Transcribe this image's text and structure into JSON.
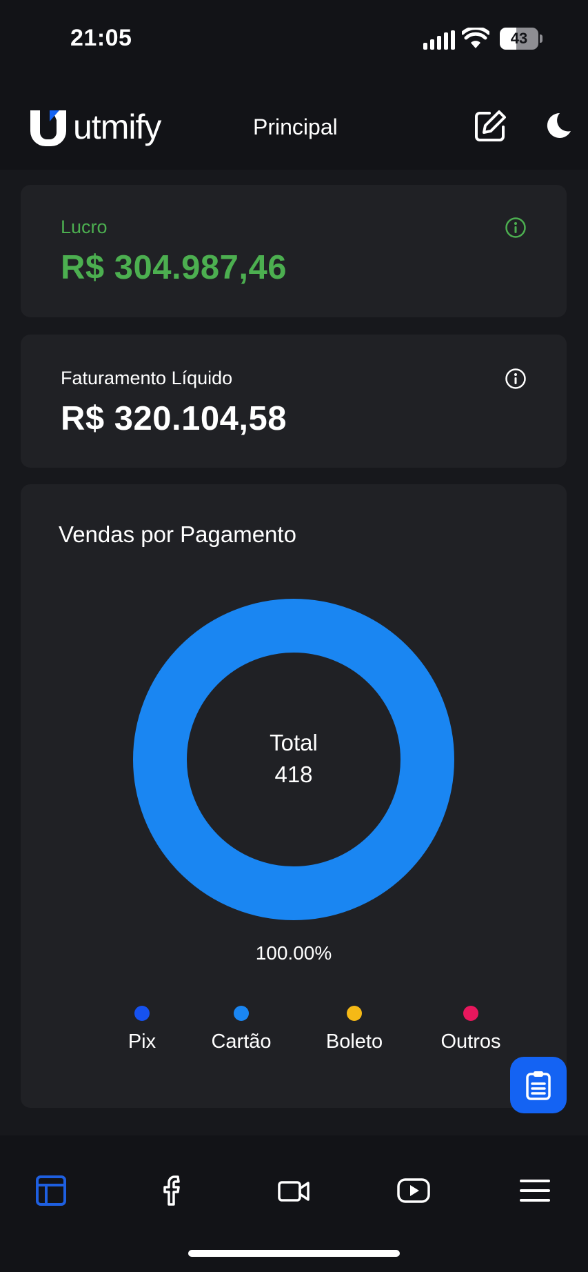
{
  "status_bar": {
    "time": "21:05",
    "battery_level": "43",
    "battery_fraction": 0.43,
    "icons": [
      "cellular-signal-icon",
      "wifi-icon",
      "battery-icon"
    ]
  },
  "header": {
    "logo_text": "utmify",
    "title": "Principal",
    "icons": [
      "edit-icon",
      "moon-icon"
    ]
  },
  "cards": {
    "profit": {
      "label": "Lucro",
      "value": "R$ 304.987,46",
      "icon": "info-icon"
    },
    "revenue": {
      "label": "Faturamento Líquido",
      "value": "R$ 320.104,58",
      "icon": "info-icon"
    }
  },
  "chart": {
    "title": "Vendas por Pagamento",
    "center_title": "Total",
    "center_value": "418",
    "slice_label": "100.00%"
  },
  "chart_data": {
    "type": "pie",
    "title": "Vendas por Pagamento",
    "donut": true,
    "total": 418,
    "categories": [
      "Pix",
      "Cartão",
      "Boleto",
      "Outros"
    ],
    "values": [
      0,
      418,
      0,
      0
    ],
    "percentages": [
      0,
      100.0,
      0,
      0
    ],
    "colors": [
      "#1652f0",
      "#1a86f2",
      "#f5b916",
      "#e8175d"
    ],
    "legend": "bottom"
  },
  "colors": {
    "profit_green": "#4caf50",
    "accent_blue": "#1463f3",
    "card_bg": "#202125",
    "page_bg": "#121317"
  },
  "fab": {
    "icon": "clipboard-icon"
  },
  "bottom_nav": {
    "items": [
      {
        "name": "dashboard",
        "icon": "dashboard-icon",
        "active": true
      },
      {
        "name": "facebook",
        "icon": "facebook-icon",
        "active": false
      },
      {
        "name": "video",
        "icon": "video-camera-icon",
        "active": false
      },
      {
        "name": "youtube",
        "icon": "youtube-icon",
        "active": false
      },
      {
        "name": "menu",
        "icon": "menu-icon",
        "active": false
      }
    ]
  }
}
